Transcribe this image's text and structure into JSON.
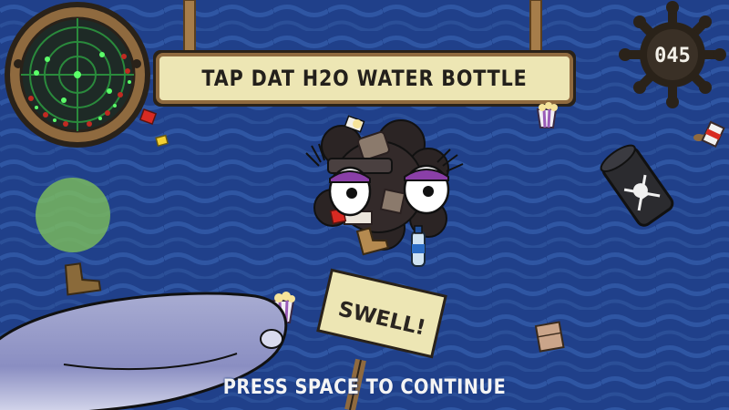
{
  "objective": {
    "text": "TAP DAT H2O WATER BOTTLE"
  },
  "counter": {
    "value": "045"
  },
  "sign": {
    "text": "SWELL!"
  },
  "prompt": {
    "text": "PRESS SPACE TO CONTINUE"
  },
  "icons": {
    "radar": "radar-minimap-icon",
    "helm": "ships-wheel-icon",
    "joystick": "virtual-joystick-icon",
    "monster": "garbage-monster-icon",
    "whale": "whale-icon",
    "barrel": "toxic-barrel-icon"
  },
  "colors": {
    "sea": "#1f3f86",
    "banner": "#ede6b4",
    "wood": "#8f6a3f",
    "joystick": "#7fc25a",
    "radar": "#2a8a3c"
  }
}
